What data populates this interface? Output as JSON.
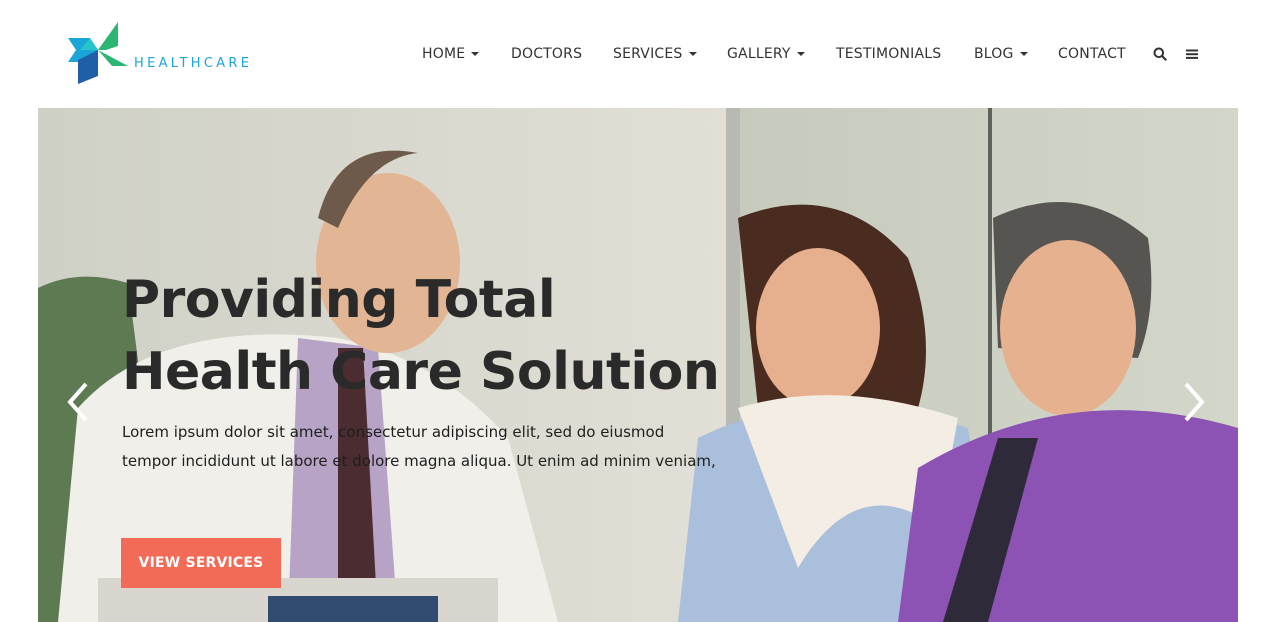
{
  "brand": {
    "name": "HEALTHCARE",
    "color": "#1aa7d8"
  },
  "nav": {
    "items": [
      {
        "label": "HOME",
        "dropdown": true
      },
      {
        "label": "DOCTORS",
        "dropdown": false
      },
      {
        "label": "SERVICES",
        "dropdown": true
      },
      {
        "label": "GALLERY",
        "dropdown": true
      },
      {
        "label": "TESTIMONIALS",
        "dropdown": false
      },
      {
        "label": "BLOG",
        "dropdown": true
      },
      {
        "label": "CONTACT",
        "dropdown": false
      }
    ],
    "icons": [
      "search-icon",
      "menu-icon"
    ]
  },
  "hero": {
    "title_line1": "Providing Total",
    "title_line2": "Health Care Solution",
    "description": "Lorem ipsum dolor sit amet, consectetur adipiscing elit, sed do eiusmod tempor incididunt ut labore et dolore magna aliqua. Ut enim ad minim veniam,",
    "button_label": "VIEW SERVICES",
    "button_color": "#f26b57",
    "prev_icon": "chevron-left-icon",
    "next_icon": "chevron-right-icon"
  }
}
